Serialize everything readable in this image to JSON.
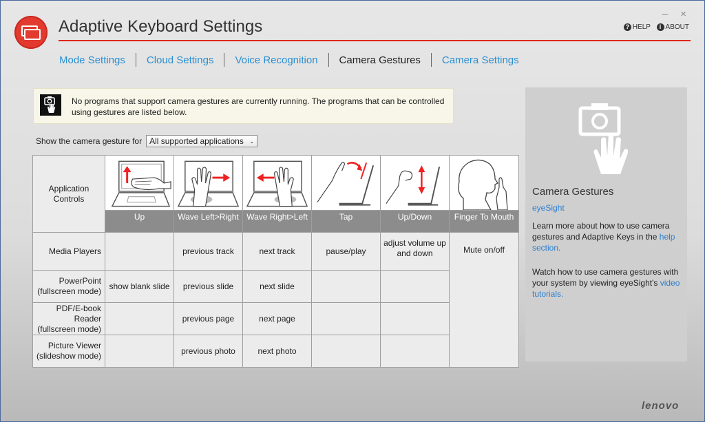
{
  "app": {
    "title": "Adaptive Keyboard Settings",
    "brand": "lenovo",
    "accent_color": "#e1251b",
    "link_color": "#2b8fd0"
  },
  "window_controls": {
    "minimize": "–",
    "close": "×"
  },
  "header_links": {
    "help": "HELP",
    "about": "ABOUT"
  },
  "tabs": [
    {
      "label": "Mode Settings",
      "active": false
    },
    {
      "label": "Cloud Settings",
      "active": false
    },
    {
      "label": "Voice Recognition",
      "active": false
    },
    {
      "label": "Camera Gestures",
      "active": true
    },
    {
      "label": "Camera Settings",
      "active": false
    }
  ],
  "notice": {
    "icon": "camera-hand-icon",
    "text": "No programs that support camera gestures are currently running. The programs that can be controlled using gestures are listed below."
  },
  "filter": {
    "label": "Show the camera gesture for",
    "selected": "All supported applications"
  },
  "table": {
    "corner_label": "Application Controls",
    "gestures": [
      {
        "label": "Up",
        "icon": "gesture-up-icon"
      },
      {
        "label": "Wave Left>Right",
        "icon": "gesture-wave-left-right-icon"
      },
      {
        "label": "Wave Right>Left",
        "icon": "gesture-wave-right-left-icon"
      },
      {
        "label": "Tap",
        "icon": "gesture-tap-icon"
      },
      {
        "label": "Up/Down",
        "icon": "gesture-up-down-icon"
      },
      {
        "label": "Finger To Mouth",
        "icon": "gesture-finger-to-mouth-icon"
      }
    ],
    "rows": [
      {
        "app": "Media Players",
        "cells": [
          "",
          "previous track",
          "next track",
          "pause/play",
          "adjust volume up and down"
        ]
      },
      {
        "app": "PowerPoint (fullscreen mode)",
        "cells": [
          "show blank slide",
          "previous slide",
          "next slide",
          "",
          ""
        ]
      },
      {
        "app": "PDF/E-book Reader (fullscreen mode)",
        "cells": [
          "",
          "previous page",
          "next page",
          "",
          ""
        ]
      },
      {
        "app": "Picture Viewer (slideshow mode)",
        "cells": [
          "",
          "previous photo",
          "next photo",
          "",
          ""
        ]
      }
    ],
    "finger_to_mouth_action": "Mute on/off"
  },
  "side": {
    "icon": "camera-gesture-icon",
    "title": "Camera Gestures",
    "subtitle": "eyeSight",
    "p1": "Learn more about how to use camera gestures and Adaptive Keys in the",
    "p1_link": "help section.",
    "p2": "Watch how to use camera gestures with your system by viewing eyeSight's",
    "p2_link": "video tutorials."
  }
}
